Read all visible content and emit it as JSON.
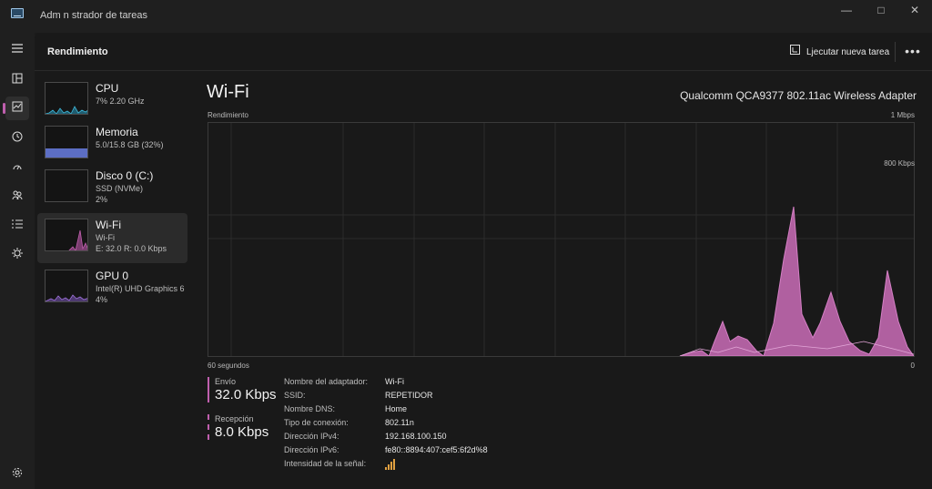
{
  "window": {
    "title": "Adm n strador de tareas",
    "minimize_icon": "—",
    "maximize_icon": "□",
    "close_icon": "✕"
  },
  "sidebar": {
    "icons": [
      "menu-icon",
      "processes-icon",
      "performance-icon",
      "history-icon",
      "startup-icon",
      "users-icon",
      "details-icon",
      "services-icon"
    ],
    "active": "performance-icon",
    "settings_icon": "settings-icon"
  },
  "header": {
    "title": "Rendimiento",
    "run_task": "Ljecutar nueva tarea",
    "more": "•••"
  },
  "list": [
    {
      "name": "CPU",
      "sub1": "7% 2.20 GHz",
      "color": "#3fb7d8"
    },
    {
      "name": "Memoria",
      "sub1": "5.0/15.8 GB (32%)",
      "color": "#7a8fe0"
    },
    {
      "name": "Disco 0 (C:)",
      "sub1": "SSD (NVMe)",
      "sub2": "2%",
      "color": "#4caf50"
    },
    {
      "name": "Wi-Fi",
      "sub1": "Wi-Fi",
      "sub2": "E: 32.0 R: 0.0 Kbps",
      "color": "#c05fae"
    },
    {
      "name": "GPU 0",
      "sub1": "Intel(R) UHD Graphics 6",
      "sub2": "4%",
      "color": "#9b6fd6"
    }
  ],
  "detail": {
    "title": "Wi-Fi",
    "adapter": "Qualcomm QCA9377 802.11ac Wireless Adapter",
    "graph_label": "Rendimiento",
    "graph_max": "1 Mbps",
    "graph_mid": "800 Kbps",
    "time_label": "60 segundos",
    "time_end": "0",
    "send_label": "Envío",
    "send_value": "32.0 Kbps",
    "recv_label": "Recepción",
    "recv_value": "8.0 Kbps",
    "properties": [
      {
        "key": "Nombre del adaptador:",
        "value": "Wi-Fi"
      },
      {
        "key": "SSID:",
        "value": "REPETIDOR"
      },
      {
        "key": "Nombre DNS:",
        "value": "Home"
      },
      {
        "key": "Tipo de conexión:",
        "value": "802.11n"
      },
      {
        "key": "Dirección IPv4:",
        "value": "192.168.100.150"
      },
      {
        "key": "Dirección IPv6:",
        "value": "fe80::8894:407:cef5:6f2d%8"
      },
      {
        "key": "Intensidad de la señal:",
        "value": ""
      }
    ],
    "accent": "#c05fae"
  }
}
